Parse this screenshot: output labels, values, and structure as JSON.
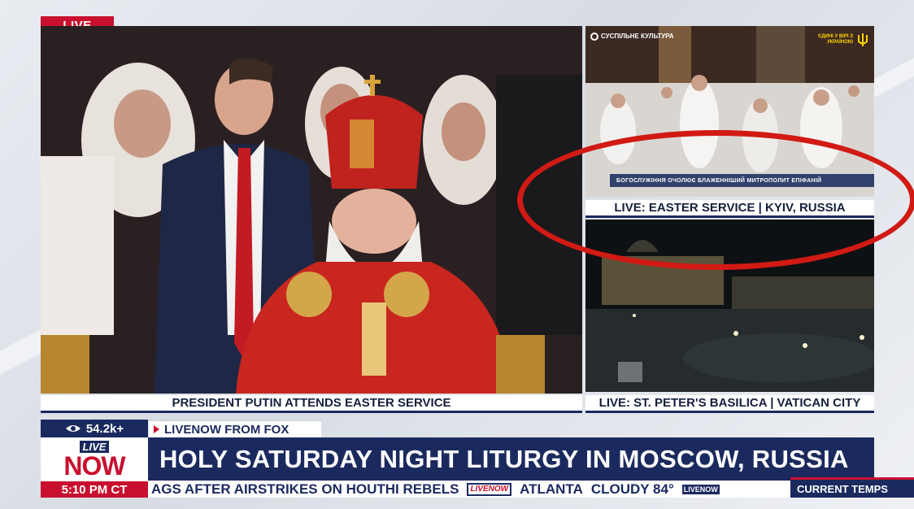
{
  "live_tag": "LIVE",
  "main_video": {
    "caption": "PRESIDENT PUTIN ATTENDS EASTER SERVICE"
  },
  "kyiv_video": {
    "channel_logo": "СУСПІЛЬНЕ КУЛЬТУРА",
    "ribbon": "ЄДИНІ У ВІРІ З УКРАЇНОЮ",
    "lower_third": "БОГОСЛУЖІННЯ ОЧОЛЮЄ БЛАЖЕННІШИЙ МИТРОПОЛИТ ЕПІФАНІЙ",
    "caption": "LIVE: EASTER SERVICE | KYIV, RUSSIA"
  },
  "vatican_video": {
    "caption": "LIVE: ST. PETER'S BASILICA | VATICAN CITY"
  },
  "lower_third": {
    "views": "54.2k+",
    "source_tab": "LIVENOW FROM FOX",
    "logo_live": "LIVE",
    "logo_now": "NOW",
    "headline": "HOLY SATURDAY NIGHT LITURGY IN MOSCOW, RUSSIA",
    "clock": "5:10 PM CT"
  },
  "ticker": {
    "text": "AGS AFTER AIRSTRIKES ON HOUTHI REBELS",
    "logo": "LIVENOW",
    "city": "ATLANTA",
    "weather": "CLOUDY 84°",
    "logo2": "LIVENOW",
    "tab": "CURRENT TEMPS"
  },
  "colors": {
    "fox_navy": "#1b2a5e",
    "fox_red": "#c8102e",
    "annotation_red": "#d11a14"
  }
}
